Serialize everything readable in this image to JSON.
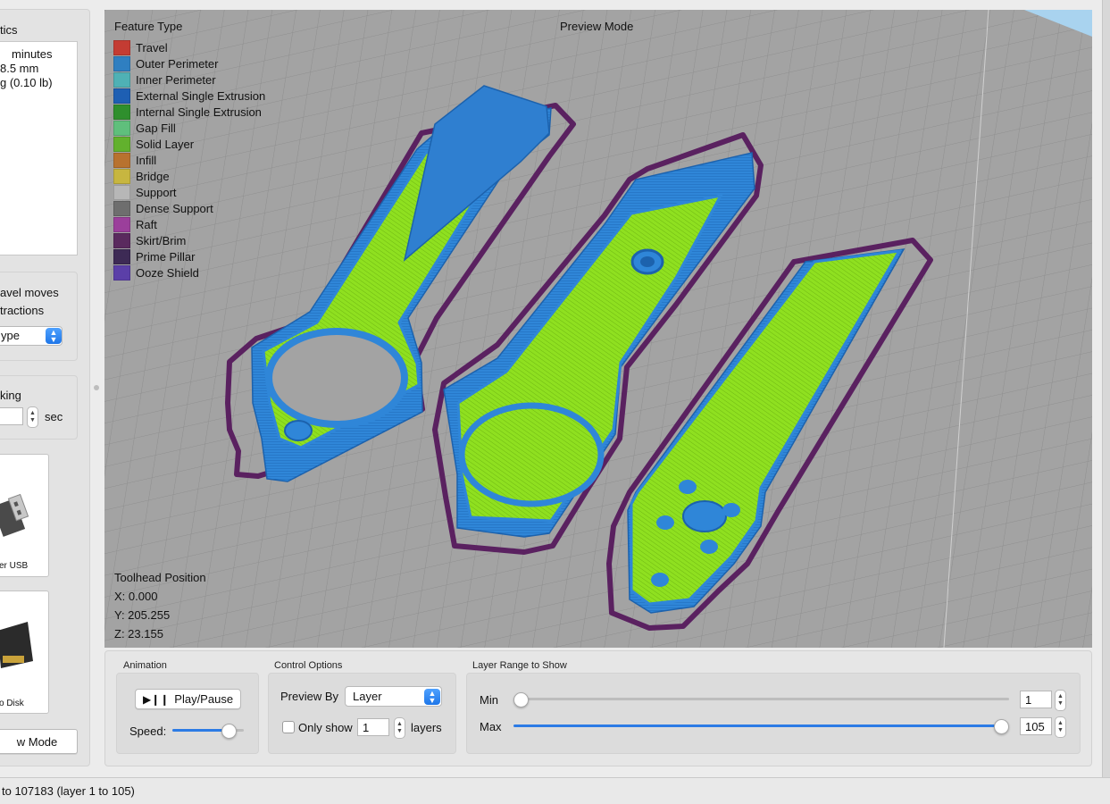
{
  "left_panel": {
    "stats_title": "tics",
    "stats_lines": [
      "minutes",
      "8.5 mm",
      "g (0.10 lb)"
    ],
    "travel_line1": "avel moves",
    "travel_line2": "tractions",
    "coloring_select": "ype",
    "ooze_label": "king",
    "ooze_unit": "sec",
    "device_usb_label": "er USB",
    "device_disk_label": "o Disk",
    "mode_button": "w Mode"
  },
  "viewport": {
    "preview_title": "Preview Mode",
    "legend_title": "Feature Type",
    "legend": [
      {
        "label": "Travel",
        "color": "#c43c33"
      },
      {
        "label": "Outer Perimeter",
        "color": "#2f7fc1"
      },
      {
        "label": "Inner Perimeter",
        "color": "#4fb1b5"
      },
      {
        "label": "External Single Extrusion",
        "color": "#1e5fb3"
      },
      {
        "label": "Internal Single Extrusion",
        "color": "#2f8f2d"
      },
      {
        "label": "Gap Fill",
        "color": "#5fbf7c"
      },
      {
        "label": "Solid Layer",
        "color": "#62b12d"
      },
      {
        "label": "Infill",
        "color": "#b8722f"
      },
      {
        "label": "Bridge",
        "color": "#c7b640"
      },
      {
        "label": "Support",
        "color": "#b7b7b7"
      },
      {
        "label": "Dense Support",
        "color": "#6e6e6e"
      },
      {
        "label": "Raft",
        "color": "#9b3f9b"
      },
      {
        "label": "Skirt/Brim",
        "color": "#5a2a5e"
      },
      {
        "label": "Prime Pillar",
        "color": "#3d2a55"
      },
      {
        "label": "Ooze Shield",
        "color": "#5b3fa8"
      }
    ],
    "toolhead_title": "Toolhead Position",
    "toolhead_x": "X: 0.000",
    "toolhead_y": "Y: 205.255",
    "toolhead_z": "Z: 23.155",
    "colors": {
      "bed": "#9d9d9d",
      "perimeter": "#2f86d8",
      "solid": "#8fe020",
      "skirt": "#5a2160"
    }
  },
  "controls": {
    "animation_title": "Animation",
    "play_pause": "Play/Pause",
    "speed_label": "Speed:",
    "speed_level": 0.85,
    "control_title": "Control Options",
    "preview_by_label": "Preview By",
    "preview_by_value": "Layer",
    "only_show_label": "Only show",
    "only_show_value": "1",
    "layers_label": "layers",
    "range_title": "Layer Range to Show",
    "min_label": "Min",
    "min_value": "1",
    "max_label": "Max",
    "max_value": "105"
  },
  "status_bar": "to 107183 (layer 1 to 105)"
}
